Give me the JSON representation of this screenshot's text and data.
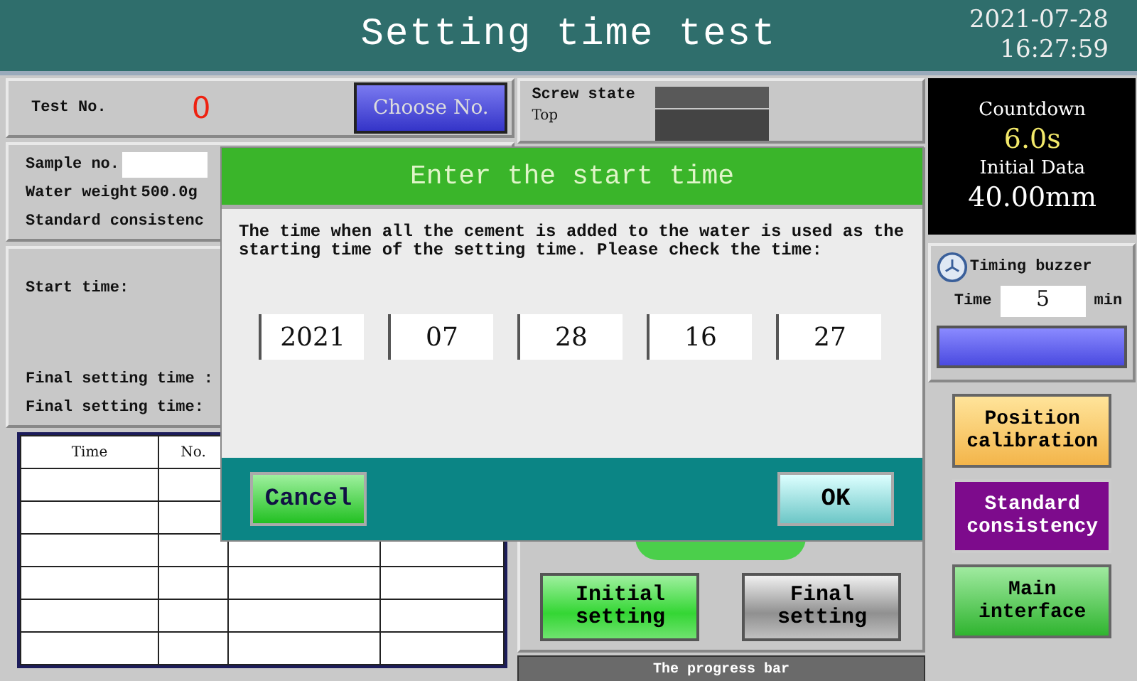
{
  "window": {
    "title": "Setting time test",
    "date": "2021-07-28",
    "time": "16:27:59"
  },
  "test": {
    "label": "Test No.",
    "value": "0",
    "button": "Choose No."
  },
  "sample": {
    "sample_label": "Sample no.",
    "water_label": "Water weight",
    "water_value": "500.0g",
    "consistency_label": "Standard consistenc"
  },
  "times": [
    "Start time:",
    "Final setting time :",
    "Final setting time:"
  ],
  "table": {
    "columns": [
      "Time",
      "No."
    ]
  },
  "screw": {
    "label": "Screw state",
    "position": "Top"
  },
  "setting_buttons": [
    {
      "label": "Initial\nsetting",
      "selected": true
    },
    {
      "label": "Final\nsetting",
      "selected": false
    }
  ],
  "progress": {
    "label": "The progress bar",
    "level": 0
  },
  "countdown": {
    "label": "Countdown",
    "value": "6.0s",
    "initial_label": "Initial Data",
    "initial_value": "40.00mm"
  },
  "buzzer": {
    "label": "Timing buzzer",
    "time_label": "Time",
    "value": "5",
    "unit": "min"
  },
  "side_buttons": [
    {
      "label": "Position\ncalibration",
      "kind": "calibration"
    },
    {
      "label": "Standard\nconsistency",
      "kind": "consistency"
    },
    {
      "label": "Main\ninterface",
      "kind": "main"
    }
  ],
  "dialog": {
    "title": "Enter the start time",
    "message": "The time when all the cement is added to the water is used as the starting time of the setting time. Please check the time:",
    "fields": [
      "2021",
      "07",
      "28",
      "16",
      "27"
    ],
    "buttons": [
      {
        "label": "Cancel",
        "kind": "cancel"
      },
      {
        "label": "OK",
        "kind": "ok"
      }
    ]
  }
}
